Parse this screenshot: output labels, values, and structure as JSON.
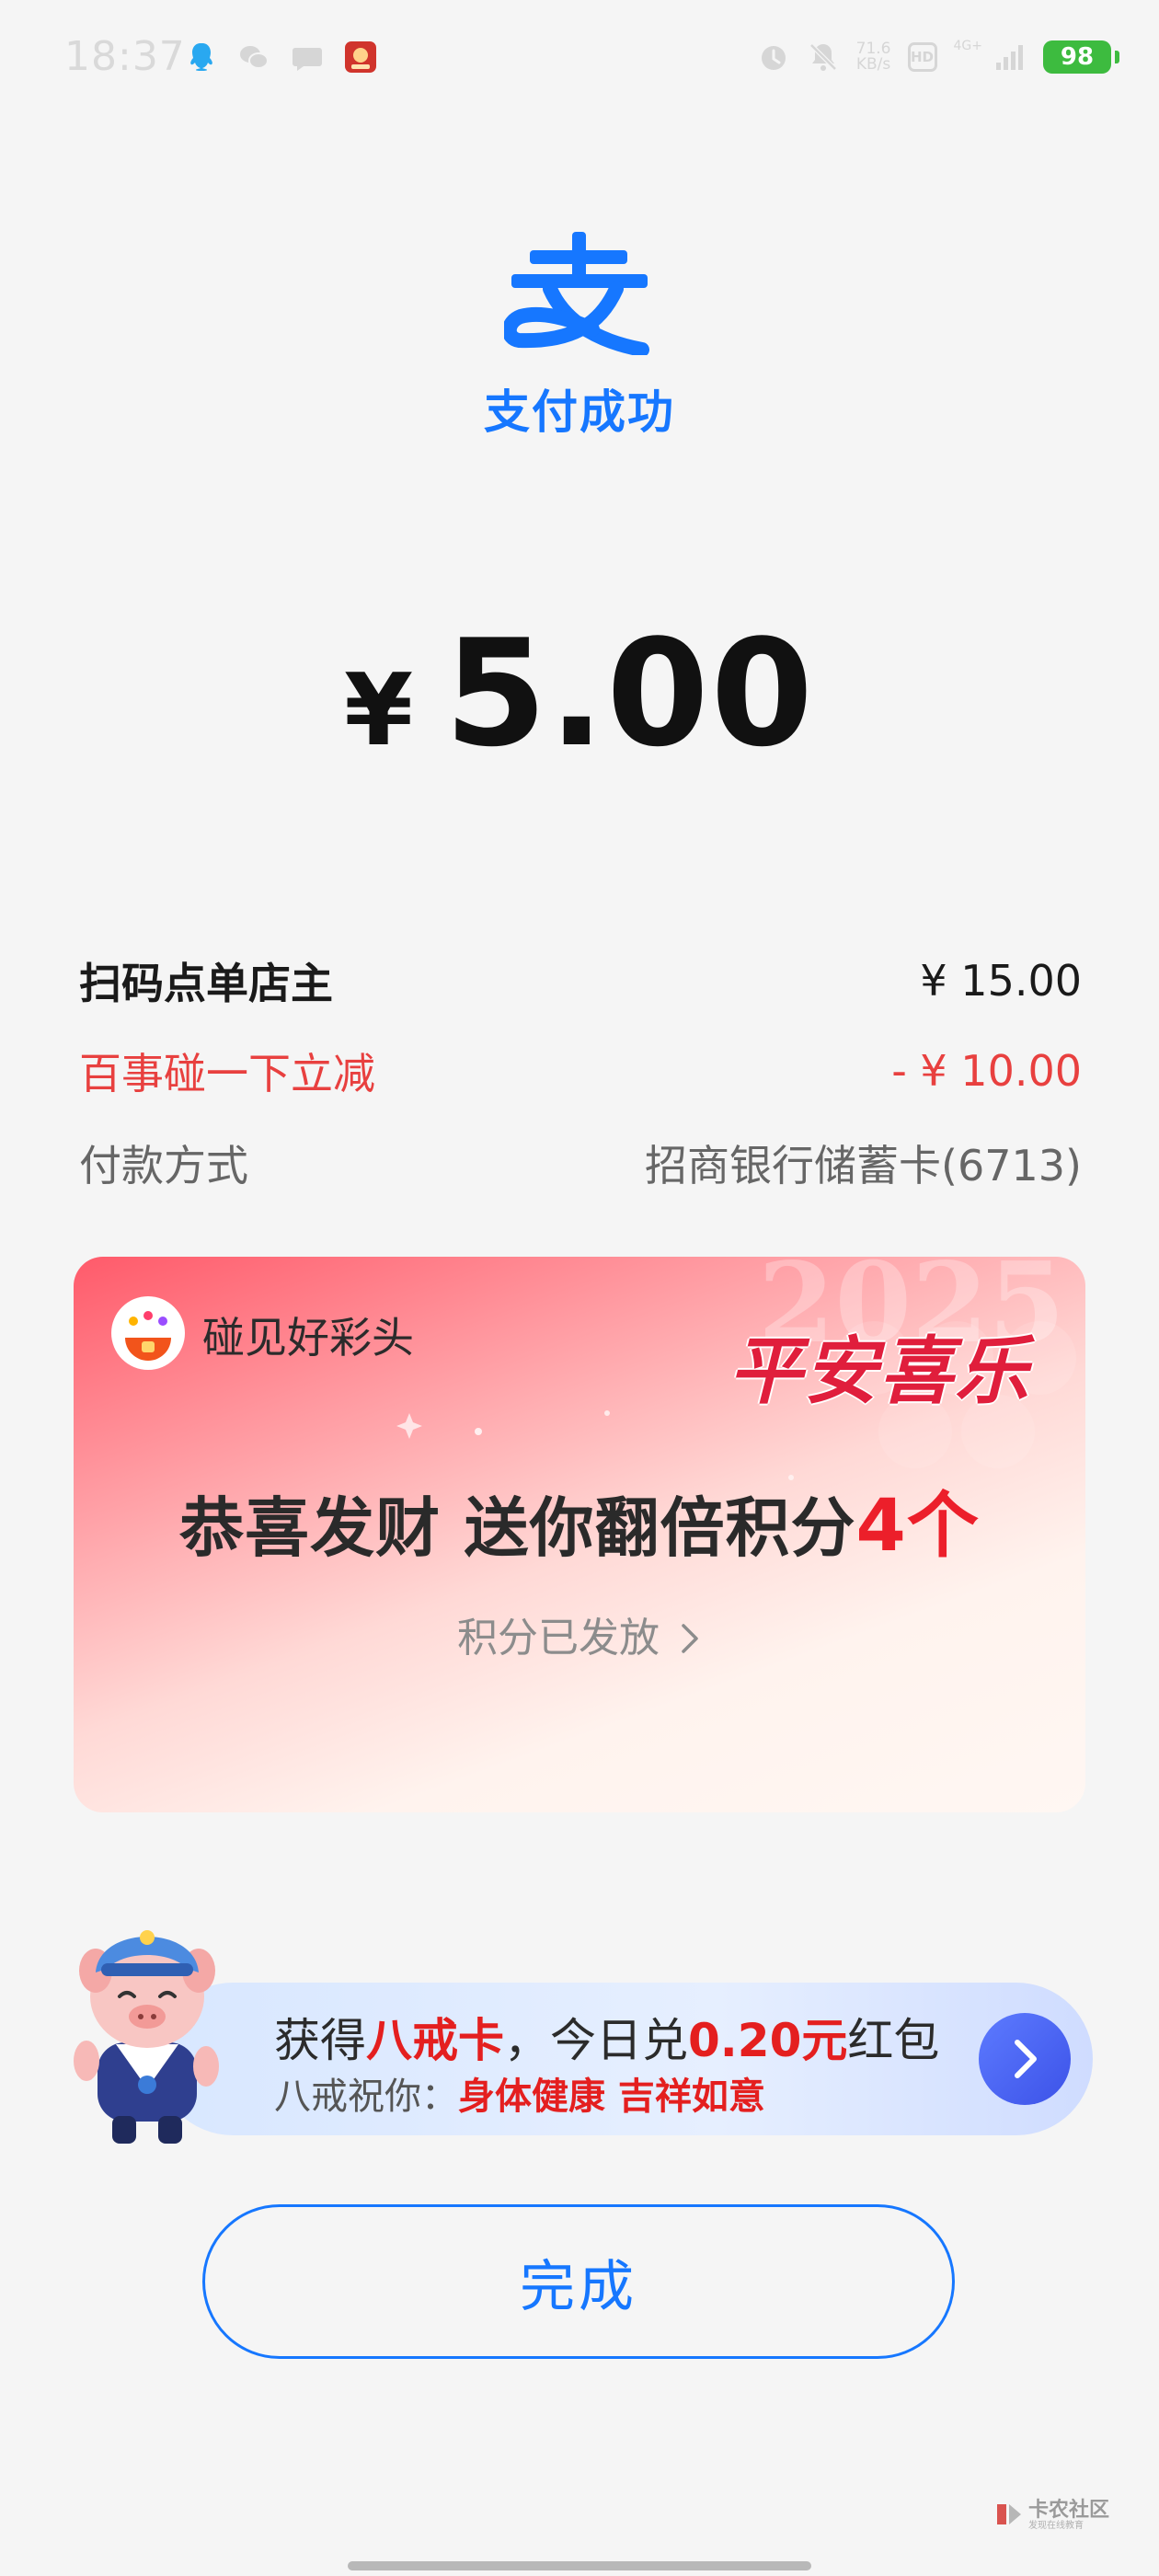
{
  "status_bar": {
    "time": "18:37",
    "net_speed_value": "71.6",
    "net_speed_unit": "KB/s",
    "hd_label": "HD",
    "signal_label": "4G+",
    "battery": "98",
    "icons": [
      "qq-icon",
      "wechat-icon",
      "message-icon",
      "app-icon",
      "alarm-icon",
      "mute-icon",
      "hd-icon",
      "signal-icon",
      "battery-icon"
    ]
  },
  "header": {
    "logo_icon": "alipay-logo-icon",
    "title": "支付成功",
    "accent_color": "#1677ff"
  },
  "amount": {
    "currency": "¥",
    "value": "5.00"
  },
  "details": {
    "merchant_label": "扫码点单店主",
    "merchant_amount": "¥ 15.00",
    "discount_label": "百事碰一下立减",
    "discount_amount": "- ¥ 10.00",
    "discount_color": "#e8403f",
    "method_label": "付款方式",
    "method_value": "招商银行储蓄卡(6713)"
  },
  "promo": {
    "brand_icon": "lucky-fan-icon",
    "brand": "碰见好彩头",
    "badge": "平安喜乐",
    "headline_prefix": "恭喜发财 送你翻倍积分",
    "headline_count": "4个",
    "link_label": "积分已发放",
    "link_icon": "chevron-right-icon",
    "bg_text": "2025"
  },
  "reward": {
    "mascot_icon": "bajie-mascot-icon",
    "line1_prefix": "获得",
    "line1_card": "八戒卡",
    "line1_middle": "，今日兑",
    "line1_amount": "0.20元",
    "line1_suffix": "红包",
    "line2_prefix": "八戒祝你：",
    "line2_blessing": "身体健康 吉祥如意",
    "arrow_icon": "chevron-right-icon"
  },
  "footer": {
    "done_label": "完成"
  },
  "watermark": {
    "text": "卡农社区",
    "sub": "发现在线教育"
  }
}
